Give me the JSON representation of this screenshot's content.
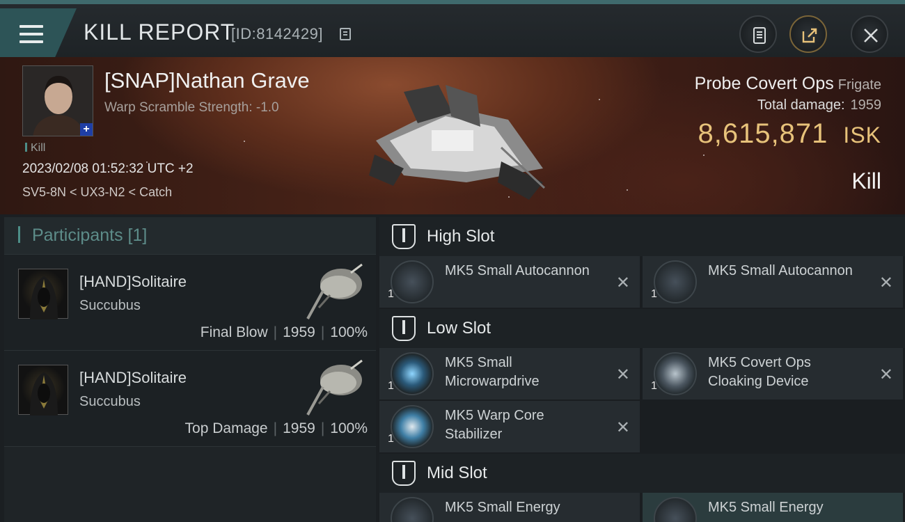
{
  "header": {
    "title": "KILL REPORT",
    "report_id": "[ID:8142429]"
  },
  "victim": {
    "pilot_name": "[SNAP]Nathan Grave",
    "stat_line": "Warp Scramble Strength: -1.0",
    "tag": "Kill",
    "datetime": "2023/02/08 01:52:32 UTC +2",
    "route": "SV5-8N < UX3-N2 < Catch",
    "ship_name": "Probe Covert Ops",
    "ship_class": "Frigate",
    "total_damage_label": "Total damage:",
    "total_damage": "1959",
    "isk_value": "8,615,871",
    "isk_unit": "ISK",
    "result": "Kill"
  },
  "participants": {
    "label": "Participants",
    "count": "[1]",
    "rows": [
      {
        "name": "[HAND]Solitaire",
        "ship": "Succubus",
        "role": "Final Blow",
        "damage": "1959",
        "percent": "100%"
      },
      {
        "name": "[HAND]Solitaire",
        "ship": "Succubus",
        "role": "Top Damage",
        "damage": "1959",
        "percent": "100%"
      }
    ]
  },
  "slots": {
    "high": {
      "label": "High Slot",
      "items": [
        {
          "qty": "1",
          "name": "MK5 Small Autocannon"
        },
        {
          "qty": "1",
          "name": "MK5 Small Autocannon"
        }
      ]
    },
    "low": {
      "label": "Low Slot",
      "items": [
        {
          "qty": "1",
          "name": "MK5 Small Microwarpdrive"
        },
        {
          "qty": "1",
          "name": "MK5 Covert Ops Cloaking Device"
        },
        {
          "qty": "1",
          "name": "MK5 Warp Core Stabilizer"
        }
      ]
    },
    "mid": {
      "label": "Mid Slot",
      "items": [
        {
          "name": "MK5 Small Energy"
        },
        {
          "name": "MK5 Small Energy"
        }
      ]
    }
  },
  "icons": {
    "menu": "hamburger-menu-icon",
    "copy": "copy-icon",
    "notes": "clipboard-icon",
    "share": "share-icon",
    "close": "close-icon",
    "remove": "x-mark-icon"
  },
  "colors": {
    "accent": "#4d8e88",
    "isk": "#e7c27a",
    "header_bar": "#2d5457"
  }
}
